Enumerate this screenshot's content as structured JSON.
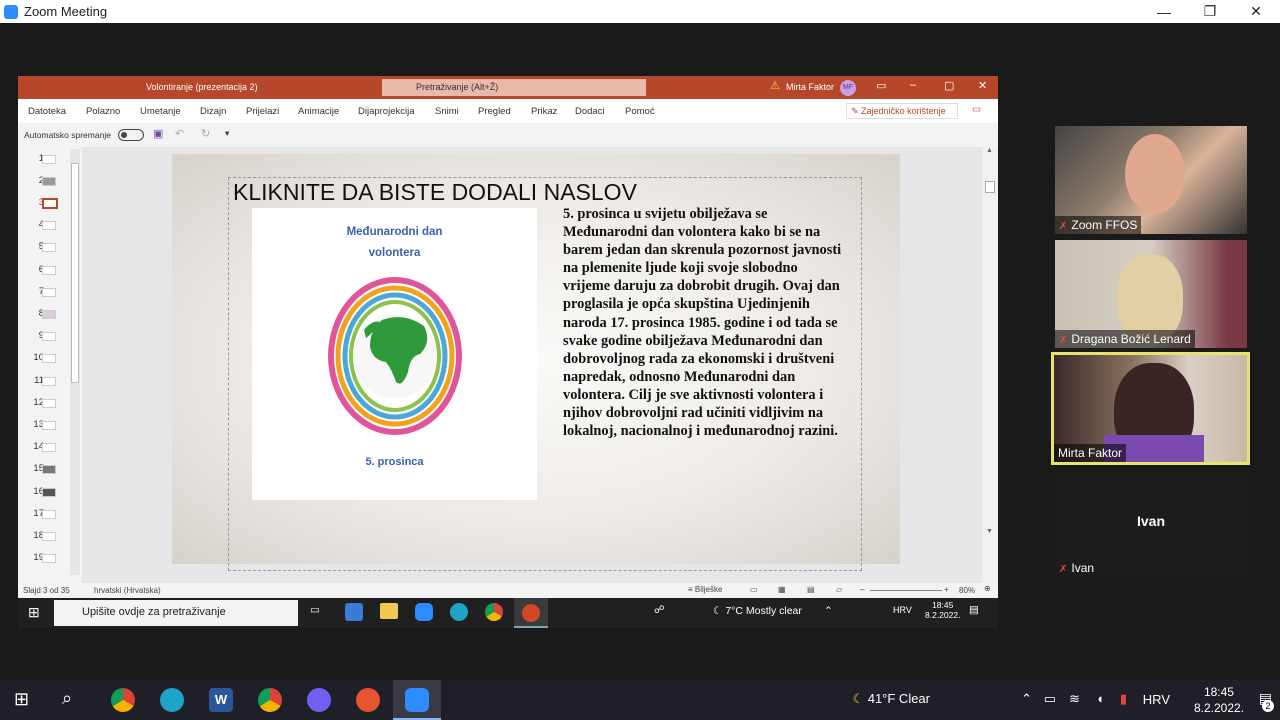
{
  "zoom": {
    "title": "Zoom Meeting"
  },
  "ppt": {
    "doc_title": "Volontiranje (prezentacija 2)",
    "search_placeholder": "Pretraživanje (Alt+Ž)",
    "user": "Mirta Faktor",
    "avatar": "MF",
    "tabs": [
      "Datoteka",
      "Polazno",
      "Umetanje",
      "Dizajn",
      "Prijelazi",
      "Animacije",
      "Dijaprojekcija",
      "Snimi",
      "Pregled",
      "Prikaz",
      "Dodaci",
      "Pomoć"
    ],
    "share_label": "Zajedničko korištenje",
    "autosave": "Automatsko spremanje",
    "thumbs": [
      "1",
      "2",
      "3",
      "4",
      "5",
      "6",
      "7",
      "8",
      "9",
      "10",
      "11",
      "12",
      "13",
      "14",
      "15",
      "16",
      "17",
      "18",
      "19"
    ],
    "slide_title": "KLIKNITE DA BISTE DODALI NASLOV",
    "img_top_line1": "Međunarodni dan",
    "img_top_line2": "volontera",
    "img_bottom": "5. prosinca",
    "slide_text": "5. prosinca u svijetu obilježava se Međunarodni dan volontera kako bi se na barem jedan dan skrenula pozornost javnosti na plemenite ljude koji svoje slobodno vrijeme daruju za dobrobit drugih. Ovaj dan proglasila je opća skupština Ujedinjenih naroda 17. prosinca 1985. godine i od tada se svake godine obilježava Međunarodni dan dobrovoljnog rada za ekonomski i društveni napredak, odnosno Međunarodni dan volontera. Cilj je sve aktivnosti volontera i njihov dobrovoljni rad učiniti vidljivim na lokalnoj, nacionalnoj i međunarodnoj razini.",
    "status_slide": "Slajd 3 od 35",
    "status_lang": "hrvatski (Hrvatska)",
    "status_notes": "Bilješke",
    "zoom_pct": "80%"
  },
  "inner_taskbar": {
    "search": "Upišite ovdje za pretraživanje",
    "weather": "7°C  Mostly clear",
    "lang": "HRV",
    "time": "18:45",
    "date": "8.2.2022."
  },
  "participants": [
    {
      "name": "Zoom FFOS"
    },
    {
      "name": "Dragana Božić Lenard"
    },
    {
      "name": "Mirta Faktor"
    },
    {
      "name": "Ivan"
    }
  ],
  "taskbar": {
    "weather": "41°F  Clear",
    "lang": "HRV",
    "time": "18:45",
    "date": "8.2.2022.",
    "notif_count": "2"
  }
}
